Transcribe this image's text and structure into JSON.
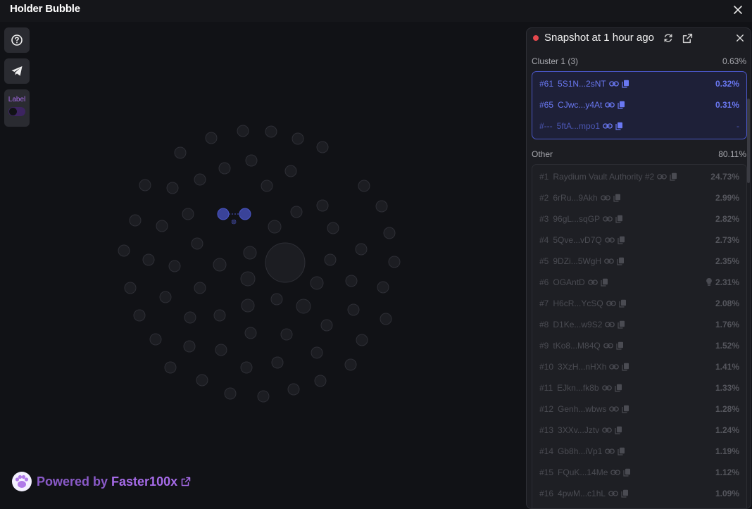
{
  "app": {
    "title": "Holder Bubble"
  },
  "sidebar": {
    "label_toggle": "Label",
    "label_enabled": false
  },
  "footer": {
    "powered_prefix": "Powered by",
    "brand": "Faster100x"
  },
  "panel": {
    "title": "Snapshot at 1 hour ago",
    "status_color": "#e5484d",
    "cluster": {
      "name": "Cluster 1 (3)",
      "percent": "0.63%",
      "rows": [
        {
          "rank": "#61",
          "address": "5S1N...2sNT",
          "percent": "0.32%"
        },
        {
          "rank": "#65",
          "address": "CJwc...y4At",
          "percent": "0.31%"
        },
        {
          "rank": "#---",
          "address": "5ftA...mpo1",
          "percent": "-"
        }
      ]
    },
    "other": {
      "name": "Other",
      "percent": "80.11%",
      "rows": [
        {
          "rank": "#1",
          "address": "Raydium Vault Authority #2",
          "percent": "24.73%"
        },
        {
          "rank": "#2",
          "address": "6rRu...9Akh",
          "percent": "2.99%"
        },
        {
          "rank": "#3",
          "address": "96gL...sqGP",
          "percent": "2.82%"
        },
        {
          "rank": "#4",
          "address": "5Qve...vD7Q",
          "percent": "2.73%"
        },
        {
          "rank": "#5",
          "address": "9DZi...5WgH",
          "percent": "2.35%"
        },
        {
          "rank": "#6",
          "address": "OGAntD",
          "percent": "2.31%",
          "bulb": true
        },
        {
          "rank": "#7",
          "address": "H6cR...YcSQ",
          "percent": "2.08%"
        },
        {
          "rank": "#8",
          "address": "D1Ke...w9S2",
          "percent": "1.76%"
        },
        {
          "rank": "#9",
          "address": "tKo8...M84Q",
          "percent": "1.52%"
        },
        {
          "rank": "#10",
          "address": "3XzH...nHXh",
          "percent": "1.41%"
        },
        {
          "rank": "#11",
          "address": "EJkn...fk8b",
          "percent": "1.33%"
        },
        {
          "rank": "#12",
          "address": "Genh...wbws",
          "percent": "1.28%"
        },
        {
          "rank": "#13",
          "address": "3XXv...Jztv",
          "percent": "1.24%"
        },
        {
          "rank": "#14",
          "address": "Gb8h...iVp1",
          "percent": "1.19%"
        },
        {
          "rank": "#15",
          "address": "FQuK...14Me",
          "percent": "1.12%"
        },
        {
          "rank": "#16",
          "address": "4pwM...c1hL",
          "percent": "1.09%"
        }
      ]
    }
  },
  "colors": {
    "background": "#111216",
    "bubble_fill": "#1c1d22",
    "bubble_stroke": "#2e2f36",
    "cluster_accent": "#4b57c9",
    "brand_purple": "#a66be8"
  },
  "icons": {
    "help": "question-circle-icon",
    "telegram": "telegram-send-icon",
    "refresh": "refresh-icon",
    "external": "external-link-icon",
    "close": "close-icon",
    "link": "link-icon",
    "copy": "copy-icon",
    "bulb": "lightbulb-icon",
    "logo": "paw-logo-icon"
  }
}
